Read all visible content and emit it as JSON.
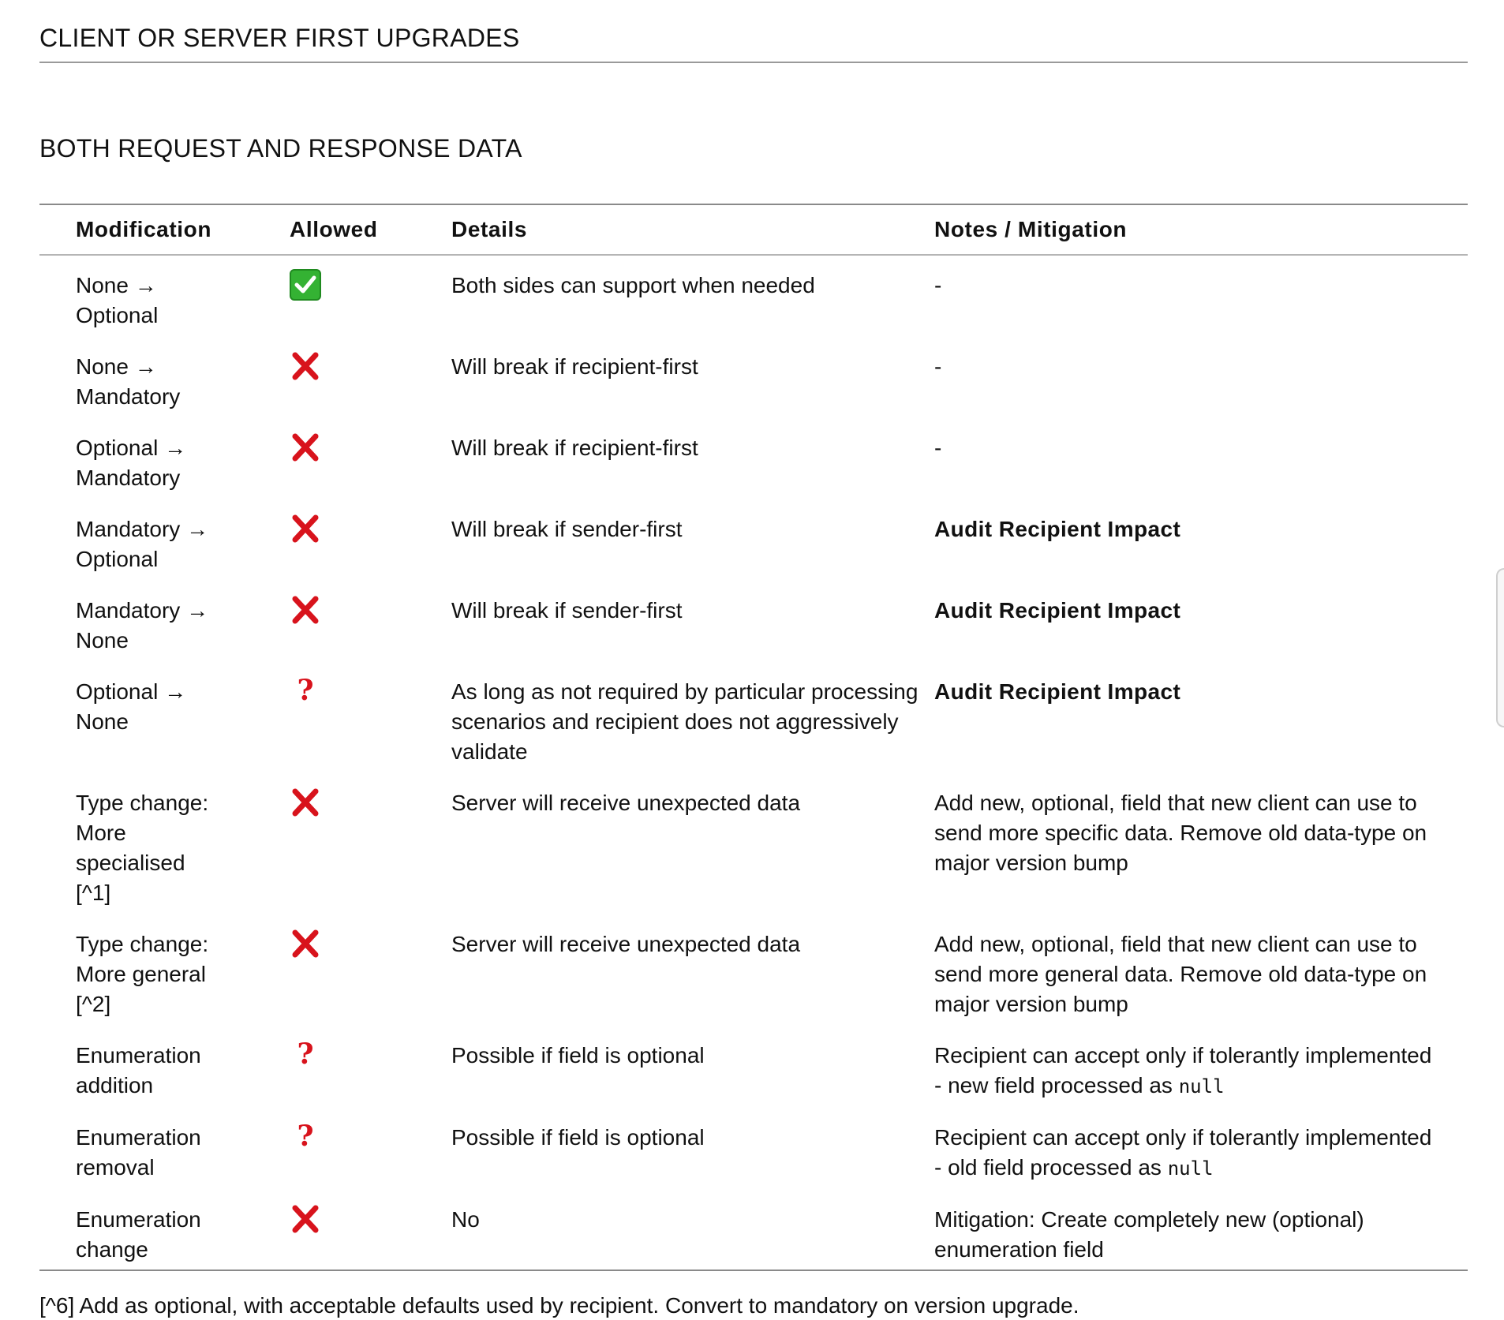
{
  "section_title": "CLIENT OR SERVER FIRST UPGRADES",
  "sub_title": "BOTH REQUEST AND RESPONSE DATA",
  "table": {
    "headers": {
      "modification": "Modification",
      "allowed": "Allowed",
      "details": "Details",
      "notes": "Notes / Mitigation"
    },
    "rows": [
      {
        "modification": "None →\nOptional",
        "allowed": "check",
        "details": "Both sides can support when needed",
        "notes": "-",
        "notes_bold": false
      },
      {
        "modification": "None →\nMandatory",
        "allowed": "cross",
        "details": "Will break if recipient-first",
        "notes": "-",
        "notes_bold": false
      },
      {
        "modification": "Optional →\nMandatory",
        "allowed": "cross",
        "details": "Will break if recipient-first",
        "notes": "-",
        "notes_bold": false
      },
      {
        "modification": "Mandatory →\nOptional",
        "allowed": "cross",
        "details": "Will break if sender-first",
        "notes": "Audit Recipient Impact",
        "notes_bold": true
      },
      {
        "modification": "Mandatory →\nNone",
        "allowed": "cross",
        "details": "Will break if sender-first",
        "notes": "Audit Recipient Impact",
        "notes_bold": true
      },
      {
        "modification": "Optional →\nNone",
        "allowed": "question",
        "details": "As long as not required by particular processing scenarios and recipient does not aggressively validate",
        "notes": "Audit Recipient Impact",
        "notes_bold": true
      },
      {
        "modification": "Type change:\nMore\nspecialised\n[^1]",
        "allowed": "cross",
        "details": "Server will receive unexpected data",
        "notes": "Add new, optional, field that new client can use to send more specific data. Remove old data-type on major version bump",
        "notes_bold": false
      },
      {
        "modification": "Type change:\nMore general\n[^2]",
        "allowed": "cross",
        "details": "Server will receive unexpected data",
        "notes": "Add new, optional, field that new client can use to send more general data. Remove old data-type on major version bump",
        "notes_bold": false
      },
      {
        "modification": "Enumeration\naddition",
        "allowed": "question",
        "details": "Possible if field is optional",
        "notes": "Recipient can accept only if tolerantly implemented - new field processed as ",
        "notes_code": "null",
        "notes_bold": false
      },
      {
        "modification": "Enumeration\nremoval",
        "allowed": "question",
        "details": "Possible if field is optional",
        "notes": "Recipient can accept only if tolerantly implemented - old field processed as ",
        "notes_code": "null",
        "notes_bold": false
      },
      {
        "modification": "Enumeration\nchange",
        "allowed": "cross",
        "details": "No",
        "notes": "Mitigation: Create completely new (optional) enumeration field",
        "notes_bold": false
      }
    ]
  },
  "footnote": "[^6] Add as optional, with acceptable defaults used by recipient. Convert to mandatory on version upgrade.",
  "icons": {
    "check": "check-mark-icon",
    "cross": "cross-mark-icon",
    "question": "question-mark-icon",
    "check_color": "#34b233",
    "cross_color": "#d8131c",
    "question_color": "#d8131c",
    "question_glyph": "?"
  }
}
